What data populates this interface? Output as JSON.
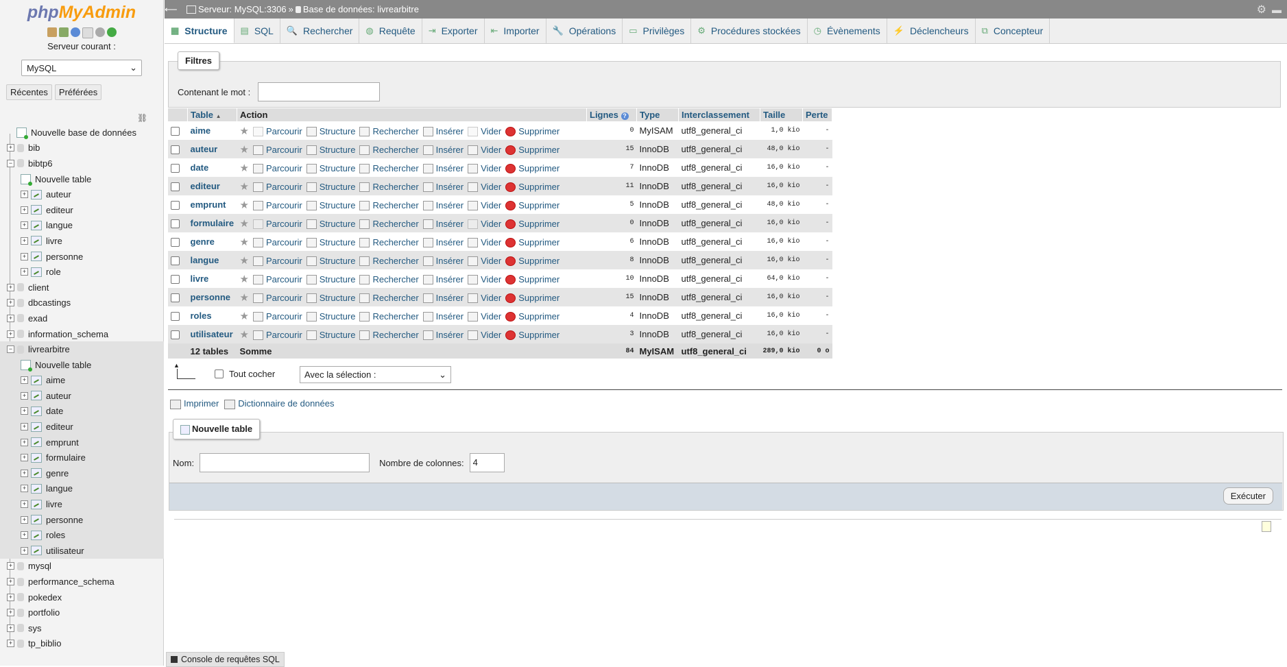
{
  "sidebar": {
    "logo_php": "php",
    "logo_myadmin": "MyAdmin",
    "server_label": "Serveur courant :",
    "server_select": "MySQL",
    "recent_button": "Récentes",
    "prefs_button": "Préférées",
    "tree": [
      {
        "label": "Nouvelle base de données",
        "level": 0,
        "kind": "new"
      },
      {
        "label": "bib",
        "level": 0,
        "kind": "db"
      },
      {
        "label": "bibtp6",
        "level": 0,
        "kind": "db",
        "expanded": true
      },
      {
        "label": "Nouvelle table",
        "level": 1,
        "kind": "newtable"
      },
      {
        "label": "auteur",
        "level": 1,
        "kind": "table"
      },
      {
        "label": "editeur",
        "level": 1,
        "kind": "table"
      },
      {
        "label": "langue",
        "level": 1,
        "kind": "table"
      },
      {
        "label": "livre",
        "level": 1,
        "kind": "table"
      },
      {
        "label": "personne",
        "level": 1,
        "kind": "table"
      },
      {
        "label": "role",
        "level": 1,
        "kind": "table"
      },
      {
        "label": "client",
        "level": 0,
        "kind": "db"
      },
      {
        "label": "dbcastings",
        "level": 0,
        "kind": "db"
      },
      {
        "label": "exad",
        "level": 0,
        "kind": "db"
      },
      {
        "label": "information_schema",
        "level": 0,
        "kind": "db"
      },
      {
        "label": "livrearbitre",
        "level": 0,
        "kind": "db",
        "expanded": true,
        "selected": true
      },
      {
        "label": "Nouvelle table",
        "level": 1,
        "kind": "newtable",
        "selected": true
      },
      {
        "label": "aime",
        "level": 1,
        "kind": "table",
        "selected": true
      },
      {
        "label": "auteur",
        "level": 1,
        "kind": "table",
        "selected": true
      },
      {
        "label": "date",
        "level": 1,
        "kind": "table",
        "selected": true
      },
      {
        "label": "editeur",
        "level": 1,
        "kind": "table",
        "selected": true
      },
      {
        "label": "emprunt",
        "level": 1,
        "kind": "table",
        "selected": true
      },
      {
        "label": "formulaire",
        "level": 1,
        "kind": "table",
        "selected": true
      },
      {
        "label": "genre",
        "level": 1,
        "kind": "table",
        "selected": true
      },
      {
        "label": "langue",
        "level": 1,
        "kind": "table",
        "selected": true
      },
      {
        "label": "livre",
        "level": 1,
        "kind": "table",
        "selected": true
      },
      {
        "label": "personne",
        "level": 1,
        "kind": "table",
        "selected": true
      },
      {
        "label": "roles",
        "level": 1,
        "kind": "table",
        "selected": true
      },
      {
        "label": "utilisateur",
        "level": 1,
        "kind": "table",
        "selected": true
      },
      {
        "label": "mysql",
        "level": 0,
        "kind": "db"
      },
      {
        "label": "performance_schema",
        "level": 0,
        "kind": "db"
      },
      {
        "label": "pokedex",
        "level": 0,
        "kind": "db"
      },
      {
        "label": "portfolio",
        "level": 0,
        "kind": "db"
      },
      {
        "label": "sys",
        "level": 0,
        "kind": "db"
      },
      {
        "label": "tp_biblio",
        "level": 0,
        "kind": "db"
      }
    ]
  },
  "topbar": {
    "server": "Serveur: MySQL:3306",
    "separator": "»",
    "database": "Base de données: livrearbitre"
  },
  "tabs": [
    {
      "label": "Structure",
      "icon": "structure-icon",
      "active": true
    },
    {
      "label": "SQL",
      "icon": "sql-icon"
    },
    {
      "label": "Rechercher",
      "icon": "search-icon"
    },
    {
      "label": "Requête",
      "icon": "query-icon"
    },
    {
      "label": "Exporter",
      "icon": "export-icon"
    },
    {
      "label": "Importer",
      "icon": "import-icon"
    },
    {
      "label": "Opérations",
      "icon": "operations-icon"
    },
    {
      "label": "Privilèges",
      "icon": "privileges-icon"
    },
    {
      "label": "Procédures stockées",
      "icon": "routines-icon"
    },
    {
      "label": "Évènements",
      "icon": "events-icon"
    },
    {
      "label": "Déclencheurs",
      "icon": "triggers-icon"
    },
    {
      "label": "Concepteur",
      "icon": "designer-icon"
    }
  ],
  "filters": {
    "legend": "Filtres",
    "label": "Contenant le mot :",
    "value": ""
  },
  "table": {
    "headers": {
      "table": "Table",
      "action": "Action",
      "rows": "Lignes",
      "type": "Type",
      "collation": "Interclassement",
      "size": "Taille",
      "overhead": "Perte"
    },
    "actions": [
      "Parcourir",
      "Structure",
      "Rechercher",
      "Insérer",
      "Vider",
      "Supprimer"
    ],
    "rows": [
      {
        "name": "aime",
        "rows": "0",
        "type": "MyISAM",
        "collation": "utf8_general_ci",
        "size": "1,0 kio",
        "overhead": "-",
        "empty": true
      },
      {
        "name": "auteur",
        "rows": "15",
        "type": "InnoDB",
        "collation": "utf8_general_ci",
        "size": "48,0 kio",
        "overhead": "-"
      },
      {
        "name": "date",
        "rows": "7",
        "type": "InnoDB",
        "collation": "utf8_general_ci",
        "size": "16,0 kio",
        "overhead": "-"
      },
      {
        "name": "editeur",
        "rows": "11",
        "type": "InnoDB",
        "collation": "utf8_general_ci",
        "size": "16,0 kio",
        "overhead": "-"
      },
      {
        "name": "emprunt",
        "rows": "5",
        "type": "InnoDB",
        "collation": "utf8_general_ci",
        "size": "48,0 kio",
        "overhead": "-"
      },
      {
        "name": "formulaire",
        "rows": "0",
        "type": "InnoDB",
        "collation": "utf8_general_ci",
        "size": "16,0 kio",
        "overhead": "-",
        "empty": true
      },
      {
        "name": "genre",
        "rows": "6",
        "type": "InnoDB",
        "collation": "utf8_general_ci",
        "size": "16,0 kio",
        "overhead": "-"
      },
      {
        "name": "langue",
        "rows": "8",
        "type": "InnoDB",
        "collation": "utf8_general_ci",
        "size": "16,0 kio",
        "overhead": "-"
      },
      {
        "name": "livre",
        "rows": "10",
        "type": "InnoDB",
        "collation": "utf8_general_ci",
        "size": "64,0 kio",
        "overhead": "-"
      },
      {
        "name": "personne",
        "rows": "15",
        "type": "InnoDB",
        "collation": "utf8_general_ci",
        "size": "16,0 kio",
        "overhead": "-"
      },
      {
        "name": "roles",
        "rows": "4",
        "type": "InnoDB",
        "collation": "utf8_general_ci",
        "size": "16,0 kio",
        "overhead": "-"
      },
      {
        "name": "utilisateur",
        "rows": "3",
        "type": "InnoDB",
        "collation": "utf8_general_ci",
        "size": "16,0 kio",
        "overhead": "-"
      }
    ],
    "footer": {
      "count": "12 tables",
      "sum_label": "Somme",
      "rows": "84",
      "type": "MyISAM",
      "collation": "utf8_general_ci",
      "size": "289,0 kio",
      "overhead": "0 o"
    }
  },
  "bulk": {
    "check_all": "Tout cocher",
    "with_selection": "Avec la sélection :"
  },
  "links": {
    "print": "Imprimer",
    "dictionary": "Dictionnaire de données"
  },
  "new_table": {
    "legend": "Nouvelle table",
    "name_label": "Nom:",
    "name_value": "",
    "columns_label": "Nombre de colonnes:",
    "columns_value": "4",
    "execute": "Exécuter"
  },
  "console": {
    "label": "Console de requêtes SQL"
  }
}
